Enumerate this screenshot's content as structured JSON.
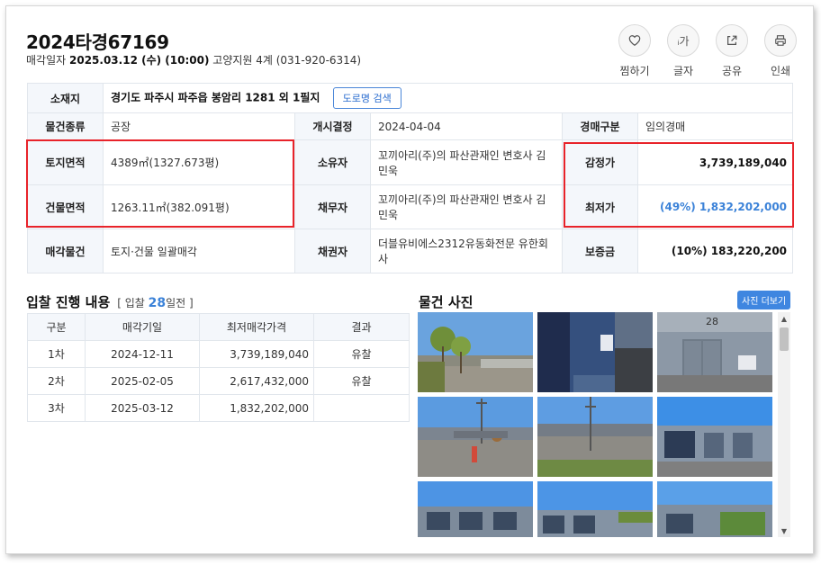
{
  "header": {
    "case_number": "2024타경67169",
    "sale_date_label": "매각일자",
    "sale_date": "2025.03.12 (수) (10:00)",
    "court": "고양지원 4계 (031-920-6314)"
  },
  "actions": [
    {
      "label": "찜하기",
      "icon": "heart-icon"
    },
    {
      "label": "글자",
      "icon": "text-size-icon",
      "glyph": "ᵢ가"
    },
    {
      "label": "공유",
      "icon": "share-icon"
    },
    {
      "label": "인쇄",
      "icon": "print-icon"
    }
  ],
  "info": {
    "location_label": "소재지",
    "location": "경기도 파주시 파주읍 봉암리 1281 외 1필지",
    "road_button": "도로명 검색",
    "type_label": "물건종류",
    "type": "공장",
    "start_label": "개시결정",
    "start": "2024-04-04",
    "auction_type_label": "경매구분",
    "auction_type": "임의경매",
    "land_label": "토지면적",
    "land": "4389㎡(1327.673평)",
    "owner_label": "소유자",
    "owner": "꼬끼아리(주)의 파산관재인 변호사 김민욱",
    "appraisal_label": "감정가",
    "appraisal": "3,739,189,040",
    "building_label": "건물면적",
    "building": "1263.11㎡(382.091평)",
    "debtor_label": "채무자",
    "debtor": "꼬끼아리(주)의 파산관재인 변호사 김민욱",
    "min_label": "최저가",
    "min_price": "(49%) 1,832,202,000",
    "sale_item_label": "매각물건",
    "sale_item": "토지·건물 일괄매각",
    "creditor_label": "채권자",
    "creditor": "더블유비에스2312유동화전문 유한회사",
    "deposit_label": "보증금",
    "deposit": "(10%) 183,220,200"
  },
  "bids": {
    "title": "입찰 진행 내용",
    "sub_prefix": "[ 입찰",
    "days": "28",
    "sub_suffix": "일전 ]",
    "columns": [
      "구분",
      "매각기일",
      "최저매각가격",
      "결과"
    ],
    "rows": [
      {
        "round": "1차",
        "date": "2024-12-11",
        "price": "3,739,189,040",
        "result": "유찰"
      },
      {
        "round": "2차",
        "date": "2025-02-05",
        "price": "2,617,432,000",
        "result": "유찰"
      },
      {
        "round": "3차",
        "date": "2025-03-12",
        "price": "1,832,202,000",
        "result": ""
      }
    ]
  },
  "photos": {
    "title": "물건 사진",
    "more_button": "사진 더보기",
    "sign_text": "28"
  },
  "colors": {
    "accent": "#3b82d8",
    "highlight": "#e8232a",
    "label_bg": "#f4f7fb"
  }
}
